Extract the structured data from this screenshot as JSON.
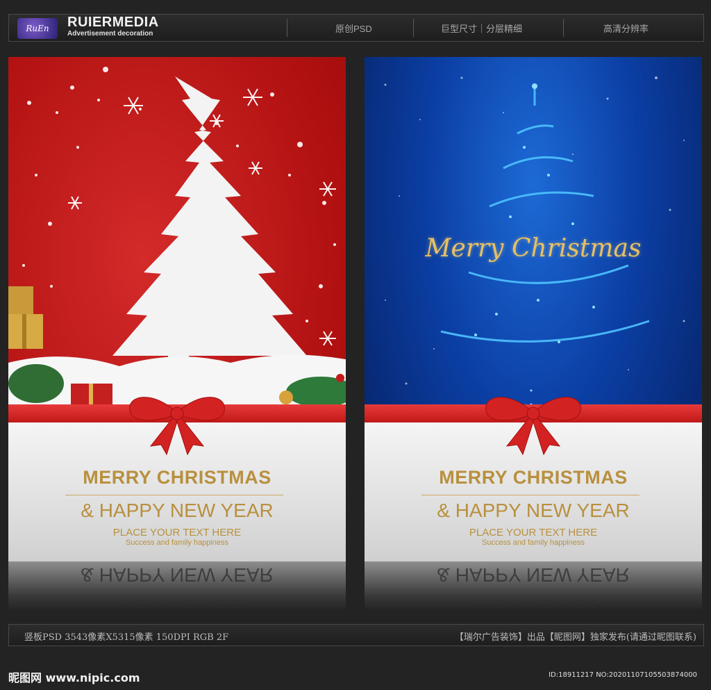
{
  "header": {
    "logo_badge": "RuEn",
    "brand_name": "RUIERMEDIA",
    "brand_sub": "Advertisement decoration",
    "items": [
      "原创PSD",
      "巨型尺寸｜分层精细",
      "高清分辨率"
    ]
  },
  "posters": [
    {
      "theme": "red",
      "title": "MERRY CHRISTMAS",
      "subtitle": "& HAPPY NEW YEAR",
      "placeholder": "PLACE YOUR TEXT HERE",
      "tagline": "Success and family happiness",
      "colors": {
        "background": "#c01a1a",
        "ribbon": "#d62828",
        "text_gold": "#b8903e",
        "tree": "#f4f4f4"
      }
    },
    {
      "theme": "blue",
      "script_title": "Merry Christmas",
      "title": "MERRY CHRISTMAS",
      "subtitle": "& HAPPY NEW YEAR",
      "placeholder": "PLACE YOUR TEXT HERE",
      "tagline": "Success and family happiness",
      "colors": {
        "background": "#0b3ea3",
        "ribbon": "#d62828",
        "text_gold": "#b8903e",
        "glow": "#4fc3ff"
      }
    }
  ],
  "footer": {
    "spec": "竖板PSD 3543像素X5315像素 150DPI RGB 2F",
    "credit": "【瑞尔广告装饰】出品【昵图网】独家发布(请通过昵图联系)",
    "site": "昵图网 www.nipic.com",
    "id_line": "ID:18911217 NO:20201107105503874000"
  }
}
